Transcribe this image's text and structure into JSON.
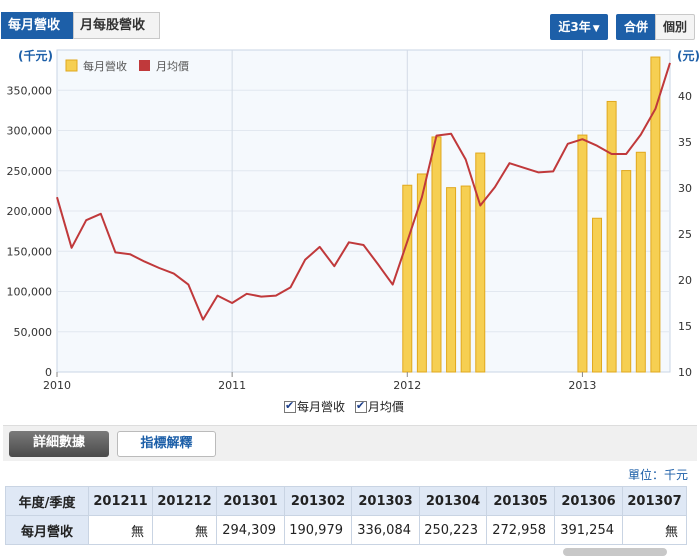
{
  "tabs": {
    "monthly_revenue": "每月營收",
    "monthly_stock": "月每股營收"
  },
  "controls": {
    "range": "近3年",
    "consolidated": "合併",
    "individual": "個別"
  },
  "colors": {
    "bar_fill": "#f6cf52",
    "bar_stroke": "#e0a81e",
    "line": "#c0393b",
    "brand": "#1d5fa8"
  },
  "chart_data": {
    "type": "bar+line",
    "ylabel_left": "(千元)",
    "ylabel_right": "(元)",
    "ylim_left": [
      0,
      400000
    ],
    "ylim_right": [
      10,
      45
    ],
    "y_ticks_left": [
      0,
      50000,
      100000,
      150000,
      200000,
      250000,
      300000,
      350000
    ],
    "y_ticks_left_labels": [
      "0",
      "50,000",
      "100,000",
      "150,000",
      "200,000",
      "250,000",
      "300,000",
      "350,000"
    ],
    "y_ticks_right": [
      10,
      15,
      20,
      25,
      30,
      35,
      40
    ],
    "x_range": [
      "2010-01",
      "2013-07"
    ],
    "x_ticks": [
      "2010",
      "2011",
      "2012",
      "2013"
    ],
    "legend": [
      "每月營收",
      "月均價"
    ],
    "series": [
      {
        "name": "每月營收",
        "type": "bar",
        "months": [
          "2012-01",
          "2012-02",
          "2012-03",
          "2012-04",
          "2012-05",
          "2012-06",
          "2013-01",
          "2013-02",
          "2013-03",
          "2013-04",
          "2013-05",
          "2013-06"
        ],
        "values": [
          232000,
          246000,
          292000,
          229000,
          231000,
          272000,
          294309,
          190979,
          336084,
          250223,
          272958,
          391254
        ]
      },
      {
        "name": "月均價",
        "type": "line",
        "months": [
          "2010-01",
          "2010-02",
          "2010-03",
          "2010-04",
          "2010-05",
          "2010-06",
          "2010-07",
          "2010-08",
          "2010-09",
          "2010-10",
          "2010-11",
          "2010-12",
          "2011-01",
          "2011-02",
          "2011-03",
          "2011-04",
          "2011-05",
          "2011-06",
          "2011-07",
          "2011-08",
          "2011-09",
          "2011-10",
          "2011-11",
          "2011-12",
          "2012-01",
          "2012-02",
          "2012-03",
          "2012-04",
          "2012-05",
          "2012-06",
          "2012-07",
          "2012-08",
          "2012-09",
          "2012-10",
          "2012-11",
          "2012-12",
          "2013-01",
          "2013-02",
          "2013-03",
          "2013-04",
          "2013-05",
          "2013-06",
          "2013-07"
        ],
        "values": [
          29,
          23.5,
          26.5,
          27.2,
          23,
          22.8,
          22,
          21.3,
          20.7,
          19.5,
          15.7,
          18.3,
          17.5,
          18.5,
          18.2,
          18.3,
          19.2,
          22.2,
          23.6,
          21.5,
          24.1,
          23.8,
          21.7,
          19.5,
          24.2,
          29,
          35.7,
          35.9,
          33.1,
          28.1,
          30.1,
          32.7,
          32.2,
          31.7,
          31.8,
          34.8,
          35.3,
          34.6,
          33.7,
          33.7,
          35.8,
          38.6,
          43.6
        ]
      }
    ]
  },
  "detail_tabs": {
    "detail": "詳細數據",
    "indicator": "指標解釋"
  },
  "unit": "單位：千元",
  "table": {
    "header": [
      "年度/季度",
      "201211",
      "201212",
      "201301",
      "201302",
      "201303",
      "201304",
      "201305",
      "201306",
      "201307"
    ],
    "row_label": "每月營收",
    "row_values": [
      "無",
      "無",
      "294,309",
      "190,979",
      "336,084",
      "250,223",
      "272,958",
      "391,254",
      "無"
    ]
  }
}
